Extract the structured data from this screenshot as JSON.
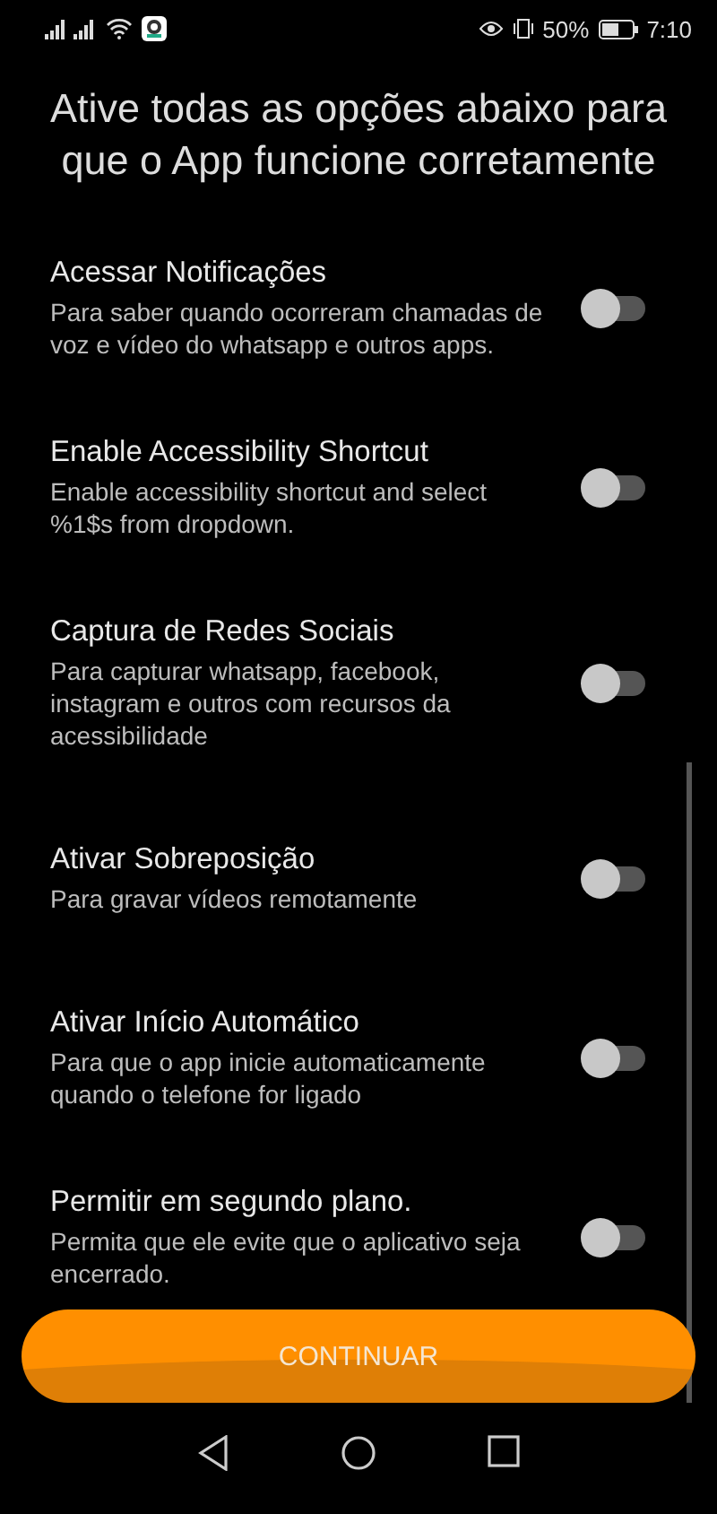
{
  "status_bar": {
    "battery": "50%",
    "time": "7:10"
  },
  "title": "Ative todas as opções abaixo para que o App funcione corretamente",
  "options": [
    {
      "title": "Acessar Notificações",
      "description": "Para saber quando ocorreram chamadas de voz e vídeo do whatsapp e outros apps.",
      "on": false
    },
    {
      "title": "Enable Accessibility Shortcut",
      "description": "Enable accessibility shortcut and select %1$s from dropdown.",
      "on": false
    },
    {
      "title": "Captura de Redes Sociais",
      "description": "Para capturar whatsapp, facebook, instagram e outros com recursos da acessibilidade",
      "on": false
    },
    {
      "title": "Ativar Sobreposição",
      "description": "Para gravar vídeos remotamente",
      "on": false
    },
    {
      "title": "Ativar Início Automático",
      "description": "Para que o app inicie automaticamente quando o telefone for ligado",
      "on": false
    },
    {
      "title": "Permitir em segundo plano.",
      "description": "Permita que ele evite que o aplicativo seja encerrado.",
      "on": false
    }
  ],
  "button": "CONTINUAR"
}
